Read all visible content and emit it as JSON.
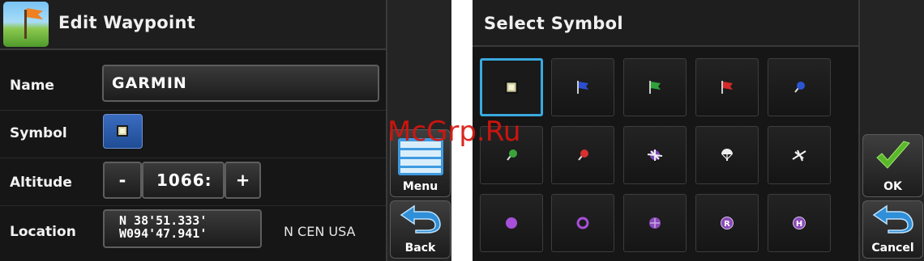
{
  "edit_waypoint": {
    "title": "Edit Waypoint",
    "name_label": "Name",
    "name_value": "GARMIN",
    "symbol_label": "Symbol",
    "altitude_label": "Altitude",
    "altitude_minus": "-",
    "altitude_value": "1066:",
    "altitude_plus": "+",
    "location_label": "Location",
    "location_lat": "N 38'51.333'",
    "location_lon": "W094'47.941'",
    "location_region": "N CEN USA",
    "menu_label": "Menu",
    "back_label": "Back"
  },
  "select_symbol": {
    "title": "Select Symbol",
    "ok_label": "OK",
    "cancel_label": "Cancel",
    "symbols": [
      [
        "square-waypoint-icon",
        "blue-flag-icon",
        "green-flag-icon",
        "red-flag-icon",
        "blue-pin-icon"
      ],
      [
        "green-pin-icon",
        "red-pin-icon",
        "airplane-crash-icon",
        "parachute-icon",
        "airport-icon"
      ],
      [
        "purple-dot-icon",
        "purple-ring-icon",
        "purple-cross-circle-icon",
        "letter-r-circle-icon",
        "letter-h-circle-icon"
      ]
    ],
    "selected_symbol": "square-waypoint-icon"
  },
  "watermark": "McGrp.Ru",
  "colors": {
    "selected_border": "#3aa9e0",
    "ok_check": "#5ab82a",
    "back_arrow": "#2f8fd8",
    "symbol_button": "#2a5aa8"
  }
}
